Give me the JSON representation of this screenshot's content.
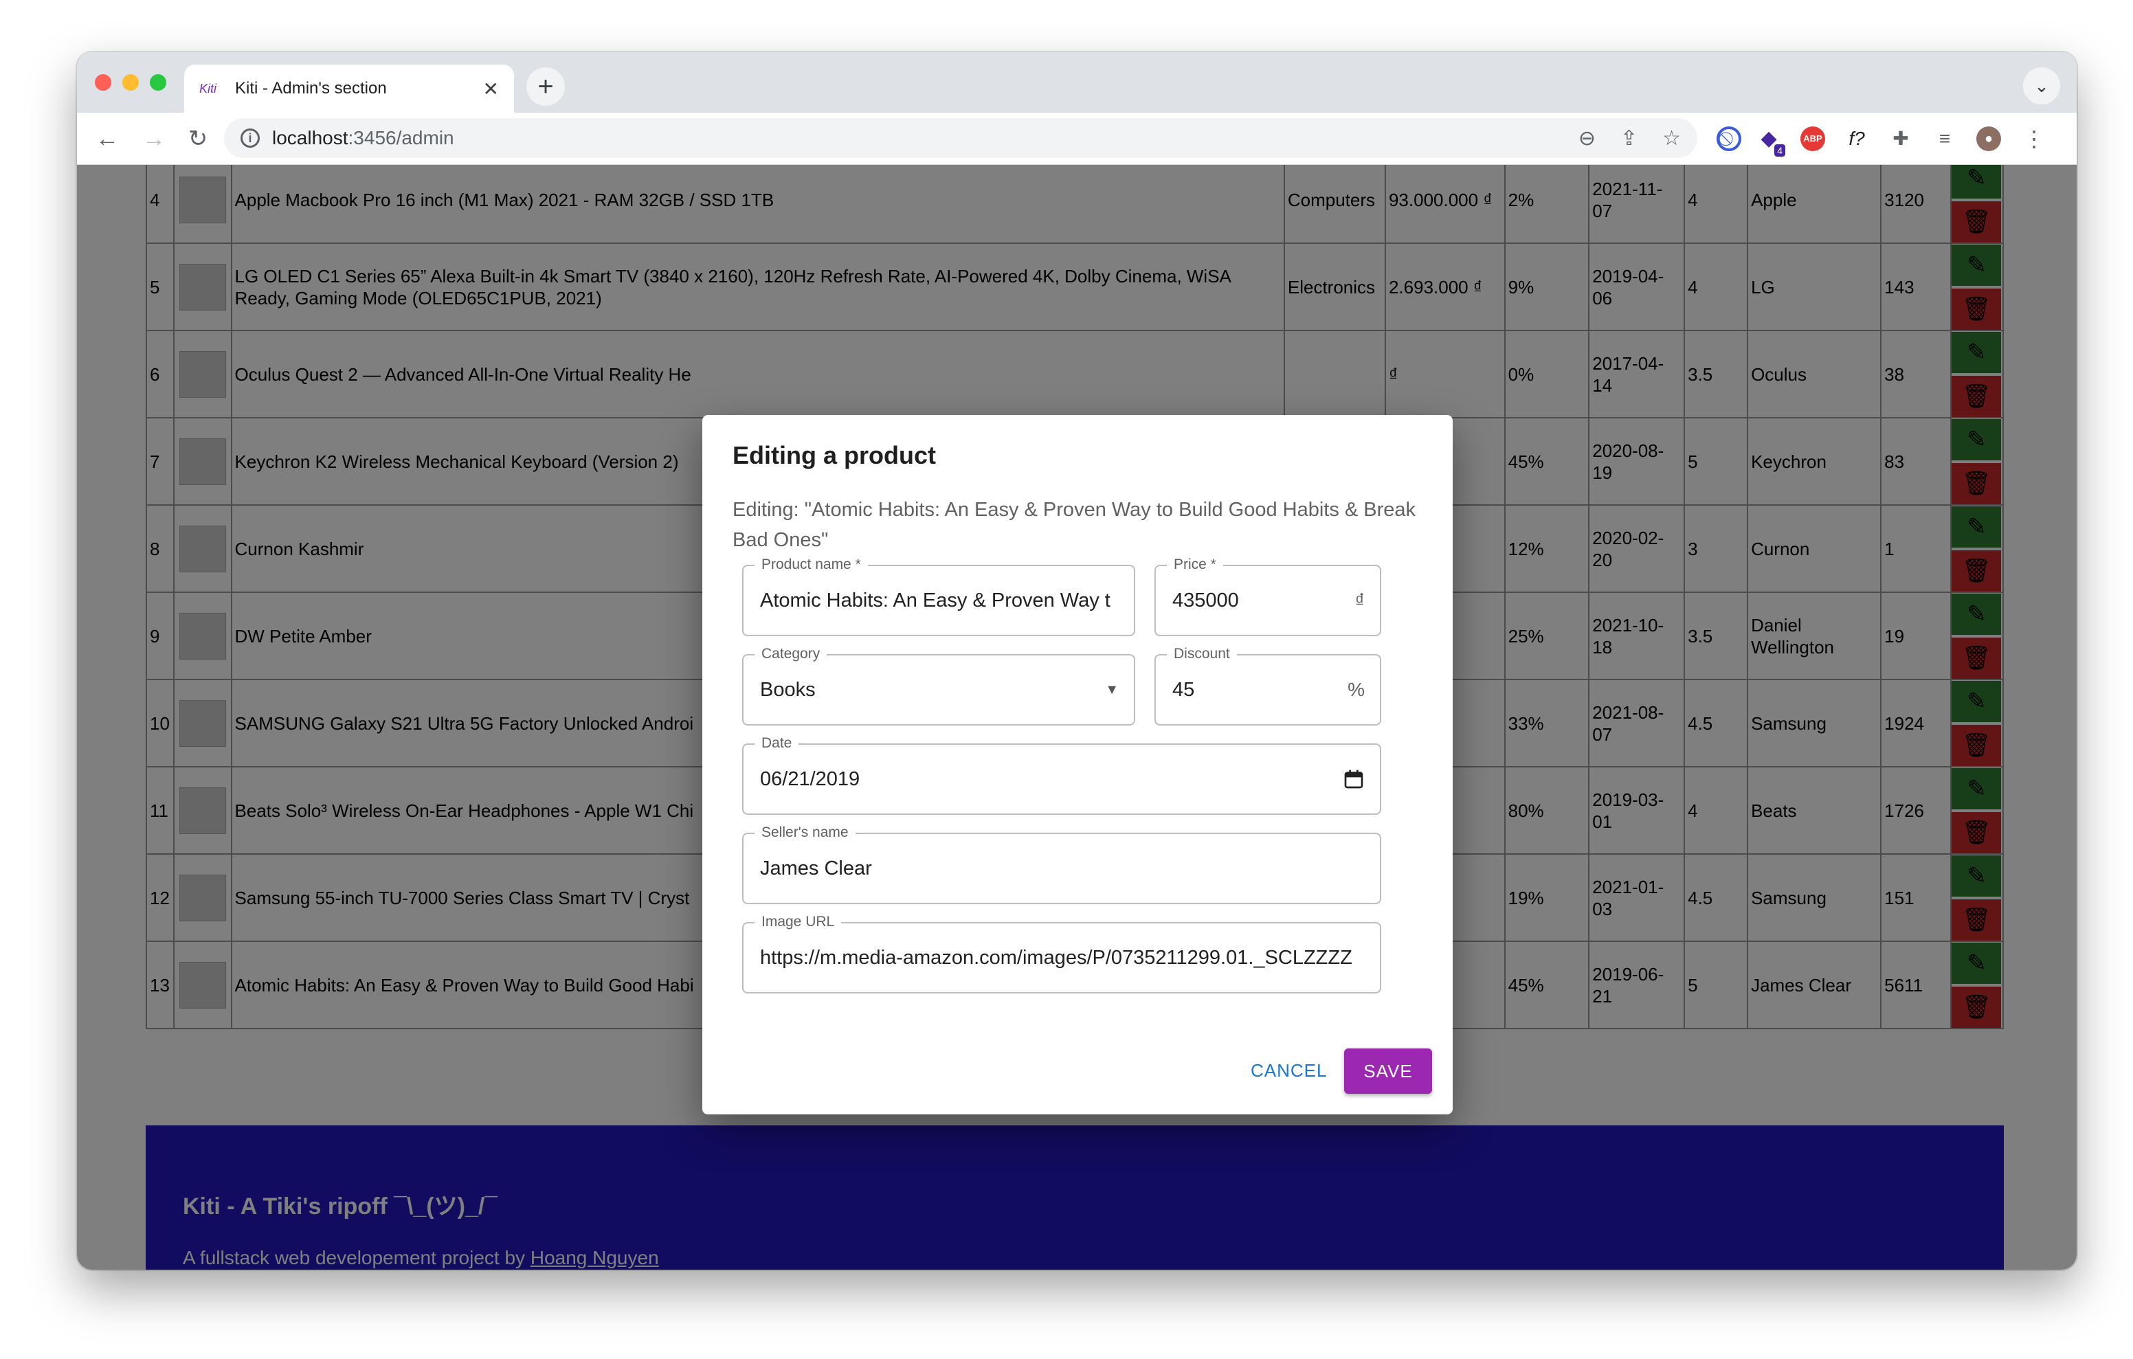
{
  "browser": {
    "tab_title": "Kiti - Admin's section",
    "favicon_text": "Kiti",
    "tab_close": "✕",
    "new_tab": "+",
    "url_host": "localhost",
    "url_rest": ":3456/admin",
    "extension_badge": "4",
    "abp_label": "ABP",
    "fx_label": "f?"
  },
  "table": {
    "rows": [
      {
        "id": "4",
        "name": "Apple Macbook Pro 16 inch (M1 Max) 2021 - RAM 32GB / SSD 1TB",
        "category": "Computers",
        "price": "93.000.000 ₫",
        "discount": "2%",
        "date": "2021-11-07",
        "rating": "4",
        "seller": "Apple",
        "sold": "3120"
      },
      {
        "id": "5",
        "name": "LG OLED C1 Series 65” Alexa Built-in 4k Smart TV (3840 x 2160), 120Hz Refresh Rate, AI-Powered 4K, Dolby Cinema, WiSA Ready, Gaming Mode (OLED65C1PUB, 2021)",
        "category": "Electronics",
        "price": "2.693.000 ₫",
        "discount": "9%",
        "date": "2019-04-06",
        "rating": "4",
        "seller": "LG",
        "sold": "143"
      },
      {
        "id": "6",
        "name": "Oculus Quest 2 — Advanced All-In-One Virtual Reality He",
        "category": "",
        "price": "₫",
        "discount": "0%",
        "date": "2017-04-14",
        "rating": "3.5",
        "seller": "Oculus",
        "sold": "38"
      },
      {
        "id": "7",
        "name": "Keychron K2 Wireless Mechanical Keyboard (Version 2)",
        "category": "",
        "price": "₫",
        "discount": "45%",
        "date": "2020-08-19",
        "rating": "5",
        "seller": "Keychron",
        "sold": "83"
      },
      {
        "id": "8",
        "name": "Curnon Kashmir",
        "category": "",
        "price": "",
        "discount": "12%",
        "date": "2020-02-20",
        "rating": "3",
        "seller": "Curnon",
        "sold": "1"
      },
      {
        "id": "9",
        "name": "DW Petite Amber",
        "category": "",
        "price": "",
        "discount": "25%",
        "date": "2021-10-18",
        "rating": "3.5",
        "seller": "Daniel Wellington",
        "sold": "19"
      },
      {
        "id": "10",
        "name": "SAMSUNG Galaxy S21 Ultra 5G Factory Unlocked Androi",
        "category": "",
        "price": "₫",
        "discount": "33%",
        "date": "2021-08-07",
        "rating": "4.5",
        "seller": "Samsung",
        "sold": "1924"
      },
      {
        "id": "11",
        "name": "Beats Solo³ Wireless On-Ear Headphones - Apple W1 Chi",
        "category": "",
        "price": "₫",
        "discount": "80%",
        "date": "2019-03-01",
        "rating": "4",
        "seller": "Beats",
        "sold": "1726"
      },
      {
        "id": "12",
        "name": "Samsung 55-inch TU-7000 Series Class Smart TV | Cryst",
        "category": "",
        "price": "₫",
        "discount": "19%",
        "date": "2021-01-03",
        "rating": "4.5",
        "seller": "Samsung",
        "sold": "151"
      },
      {
        "id": "13",
        "name": "Atomic Habits: An Easy & Proven Way to Build Good Habi",
        "category": "",
        "price": "",
        "discount": "45%",
        "date": "2019-06-21",
        "rating": "5",
        "seller": "James Clear",
        "sold": "5611"
      }
    ]
  },
  "footer": {
    "title": "Kiti - A Tiki's ripoff ¯\\_(ツ)_/¯",
    "subtitle_prefix": "A fullstack web developement project by ",
    "author_link": "Hoang Nguyen"
  },
  "dialog": {
    "title": "Editing a product",
    "description": "Editing: \"Atomic Habits: An Easy & Proven Way to Build Good Habits & Break Bad Ones\"",
    "product_name_label": "Product name *",
    "product_name_value": "Atomic Habits: An Easy & Proven Way t",
    "price_label": "Price *",
    "price_value": "435000",
    "price_unit": "₫",
    "category_label": "Category",
    "category_value": "Books",
    "discount_label": "Discount",
    "discount_value": "45",
    "discount_unit": "%",
    "date_label": "Date",
    "date_value": "06/21/2019",
    "seller_label": "Seller's name",
    "seller_value": "James Clear",
    "image_url_label": "Image URL",
    "image_url_value": "https://m.media-amazon.com/images/P/0735211299.01._SCLZZZZ",
    "cancel_label": "CANCEL",
    "save_label": "SAVE"
  },
  "colors": {
    "accent_save": "#9c27b0",
    "cancel_text": "#1976d2",
    "footer_bg": "#2418c0",
    "edit_button": "#2e7d32",
    "delete_button": "#c62828"
  }
}
